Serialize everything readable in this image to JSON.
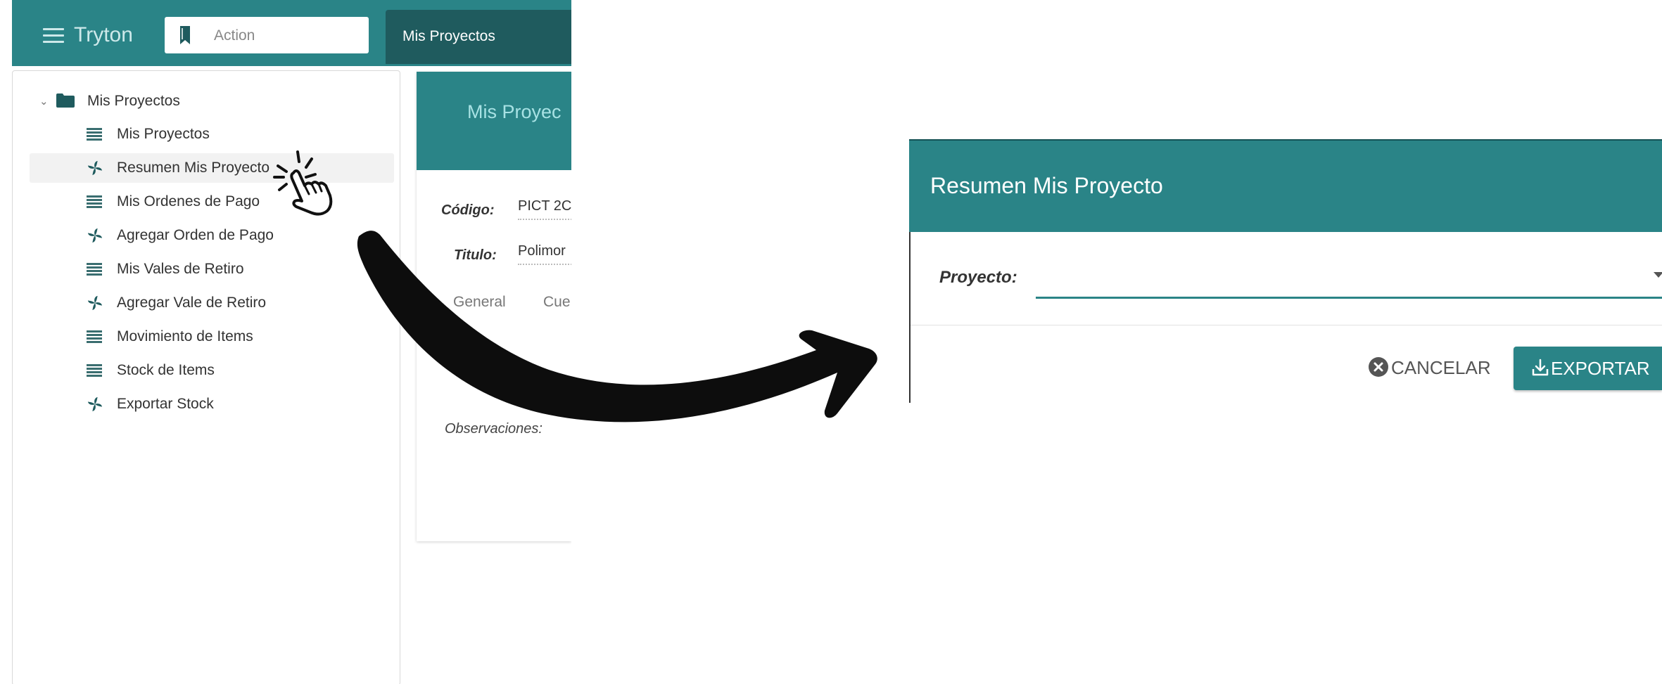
{
  "app": {
    "brand": "Tryton",
    "search_placeholder": "Action",
    "active_tab": "Mis Proyectos"
  },
  "sidebar": {
    "root_label": "Mis Proyectos",
    "items": [
      {
        "label": "Mis Proyectos",
        "icon": "list-icon"
      },
      {
        "label": "Resumen Mis Proyecto",
        "icon": "wizard-icon",
        "highlighted": true
      },
      {
        "label": "Mis Ordenes de Pago",
        "icon": "list-icon"
      },
      {
        "label": "Agregar Orden de Pago",
        "icon": "wizard-icon"
      },
      {
        "label": "Mis Vales de Retiro",
        "icon": "list-icon"
      },
      {
        "label": "Agregar Vale de Retiro",
        "icon": "wizard-icon"
      },
      {
        "label": "Movimiento de Items",
        "icon": "list-icon"
      },
      {
        "label": "Stock de Items",
        "icon": "list-icon"
      },
      {
        "label": "Exportar Stock",
        "icon": "wizard-icon"
      }
    ]
  },
  "form": {
    "header_title": "Mis Proyec",
    "codigo_label": "Código:",
    "codigo_value": "PICT 2C",
    "titulo_label": "Titulo:",
    "titulo_value": "Polimor",
    "tabs": [
      "General",
      "Cue"
    ],
    "observaciones_label": "Observaciones:"
  },
  "dialog": {
    "title": "Resumen Mis Proyecto",
    "proyecto_label": "Proyecto:",
    "cancel_label": "CANCELAR",
    "export_label": "EXPORTAR"
  },
  "colors": {
    "accent": "#2a8487",
    "accent_dark": "#1f5b5e"
  }
}
